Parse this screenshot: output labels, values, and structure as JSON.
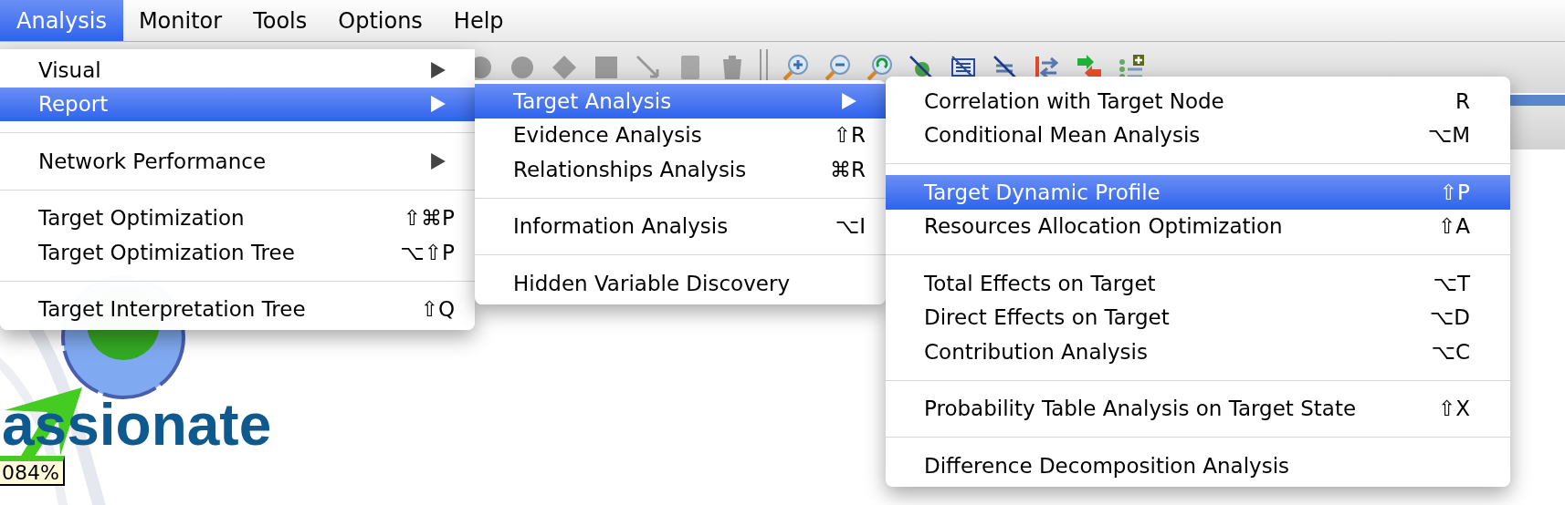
{
  "menubar": [
    {
      "label": "Analysis",
      "selected": true
    },
    {
      "label": "Monitor",
      "selected": false
    },
    {
      "label": "Tools",
      "selected": false
    },
    {
      "label": "Options",
      "selected": false
    },
    {
      "label": "Help",
      "selected": false
    }
  ],
  "menus": [
    {
      "items": [
        {
          "kind": "item",
          "label": "Visual",
          "submenu": true,
          "selected": false
        },
        {
          "kind": "item",
          "label": "Report",
          "submenu": true,
          "selected": true
        },
        {
          "kind": "separator"
        },
        {
          "kind": "item",
          "label": "Network Performance",
          "submenu": true,
          "selected": false
        },
        {
          "kind": "separator"
        },
        {
          "kind": "item",
          "label": "Target Optimization",
          "shortcut": "⇧⌘P",
          "submenu": false,
          "selected": false
        },
        {
          "kind": "item",
          "label": "Target Optimization Tree",
          "shortcut": "⌥⇧P",
          "submenu": false,
          "selected": false
        },
        {
          "kind": "separator"
        },
        {
          "kind": "item",
          "label": "Target Interpretation Tree",
          "shortcut": "⇧Q",
          "submenu": false,
          "selected": false
        }
      ]
    },
    {
      "items": [
        {
          "kind": "item",
          "label": "Target Analysis",
          "submenu": true,
          "selected": true
        },
        {
          "kind": "item",
          "label": "Evidence Analysis",
          "shortcut": "⇧R",
          "submenu": false,
          "selected": false
        },
        {
          "kind": "item",
          "label": "Relationships Analysis",
          "shortcut": "⌘R",
          "submenu": false,
          "selected": false
        },
        {
          "kind": "separator"
        },
        {
          "kind": "item",
          "label": "Information Analysis",
          "shortcut": "⌥I",
          "submenu": false,
          "selected": false
        },
        {
          "kind": "separator"
        },
        {
          "kind": "item",
          "label": "Hidden Variable Discovery",
          "submenu": false,
          "selected": false
        }
      ]
    },
    {
      "items": [
        {
          "kind": "item",
          "label": "Correlation with Target Node",
          "shortcut": "R",
          "submenu": false,
          "selected": false
        },
        {
          "kind": "item",
          "label": "Conditional Mean Analysis",
          "shortcut": "⌥M",
          "submenu": false,
          "selected": false
        },
        {
          "kind": "separator"
        },
        {
          "kind": "item",
          "label": "Target Dynamic Profile",
          "shortcut": "⇧P",
          "submenu": false,
          "selected": true
        },
        {
          "kind": "item",
          "label": "Resources Allocation Optimization",
          "shortcut": "⇧A",
          "submenu": false,
          "selected": false
        },
        {
          "kind": "separator"
        },
        {
          "kind": "item",
          "label": "Total Effects on Target",
          "shortcut": "⌥T",
          "submenu": false,
          "selected": false
        },
        {
          "kind": "item",
          "label": "Direct Effects on Target",
          "shortcut": "⌥D",
          "submenu": false,
          "selected": false
        },
        {
          "kind": "item",
          "label": "Contribution Analysis",
          "shortcut": "⌥C",
          "submenu": false,
          "selected": false
        },
        {
          "kind": "separator"
        },
        {
          "kind": "item",
          "label": "Probability Table Analysis on Target State",
          "shortcut": "⇧X",
          "submenu": false,
          "selected": false
        },
        {
          "kind": "separator"
        },
        {
          "kind": "item",
          "label": "Difference Decomposition Analysis",
          "submenu": false,
          "selected": false
        }
      ]
    }
  ],
  "canvas": {
    "node_label": "assionate",
    "value_label": "084%"
  }
}
